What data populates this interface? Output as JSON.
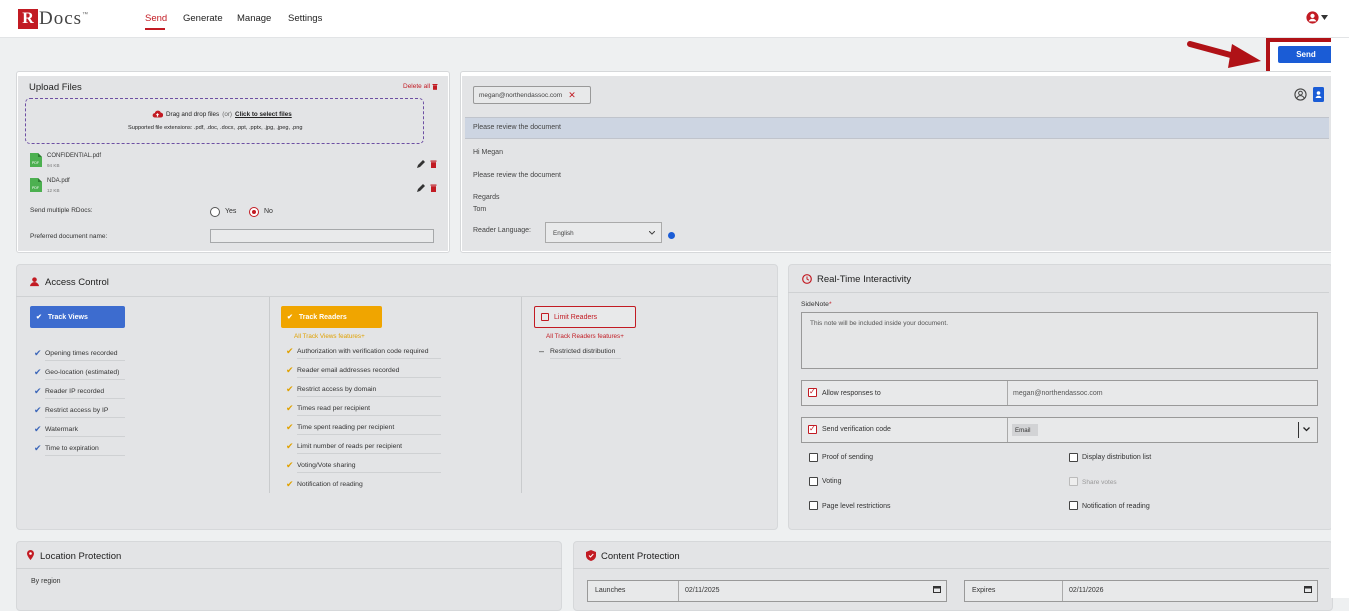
{
  "app": {
    "logo_r": "R",
    "logo_rest": "Docs",
    "logo_tm": "™"
  },
  "nav": {
    "send": "Send",
    "generate": "Generate",
    "manage": "Manage",
    "settings": "Settings"
  },
  "toolbar": {
    "send_label": "Send"
  },
  "upload": {
    "title": "Upload Files",
    "delete_all": "Delete all",
    "drop_text": "Drag and drop files",
    "drop_or": "(or)",
    "drop_link": "Click to select files",
    "supported": "Supported file extensions: .pdf, .doc, .docx, .ppt, .pptx, .jpg, .jpeg, .png",
    "files": [
      {
        "name": "CONFIDENTIAL.pdf",
        "size": "94 KB"
      },
      {
        "name": "NDA.pdf",
        "size": "12 KB"
      }
    ],
    "multi_label": "Send multiple RDocs:",
    "yes": "Yes",
    "no": "No",
    "selected": "No",
    "pref_name_label": "Preferred document name:",
    "pref_name_value": ""
  },
  "message": {
    "recipient": "megan@northendassoc.com",
    "subject": "Please review the document",
    "body_lines": [
      "Hi Megan",
      "Please review the document",
      "Regards",
      "Tom"
    ],
    "reader_lang_label": "Reader Language:",
    "reader_lang_value": "English"
  },
  "access": {
    "title": "Access Control",
    "track_views": {
      "label": "Track Views",
      "items": [
        "Opening times recorded",
        "Geo-location (estimated)",
        "Reader IP recorded",
        "Restrict access by IP",
        "Watermark",
        "Time to expiration"
      ]
    },
    "track_readers": {
      "label": "Track Readers",
      "sub": "All Track Views features+",
      "items": [
        "Authorization with verification code required",
        "Reader email addresses recorded",
        "Restrict access by domain",
        "Times read per recipient",
        "Time spent reading per recipient",
        "Limit number of reads per recipient",
        "Voting/Vote sharing",
        "Notification of reading"
      ]
    },
    "limit_readers": {
      "label": "Limit Readers",
      "sub": "All Track Readers features+",
      "items": [
        "Restricted distribution"
      ]
    }
  },
  "realtime": {
    "title": "Real-Time Interactivity",
    "sidenote_label": "SideNote",
    "sidenote_required": "*",
    "sidenote_placeholder": "This note will be included inside your document.",
    "allow_responses_label": "Allow responses to",
    "allow_responses_value": "megan@northendassoc.com",
    "verification_label": "Send verification code",
    "verification_value": "Email",
    "options": {
      "proof": "Proof of sending",
      "display_list": "Display distribution list",
      "voting": "Voting",
      "share_votes": "Share votes",
      "page_level": "Page level restrictions",
      "notification": "Notification of reading"
    }
  },
  "location": {
    "title": "Location Protection",
    "by_region": "By region"
  },
  "content": {
    "title": "Content Protection",
    "launches_label": "Launches",
    "launches_value": "02/11/2025",
    "expires_label": "Expires",
    "expires_value": "02/11/2026"
  },
  "colors": {
    "brand_red": "#c21b23",
    "blue": "#1a5cd6",
    "track_views": "#3d6ccf",
    "track_readers": "#f0a500"
  }
}
